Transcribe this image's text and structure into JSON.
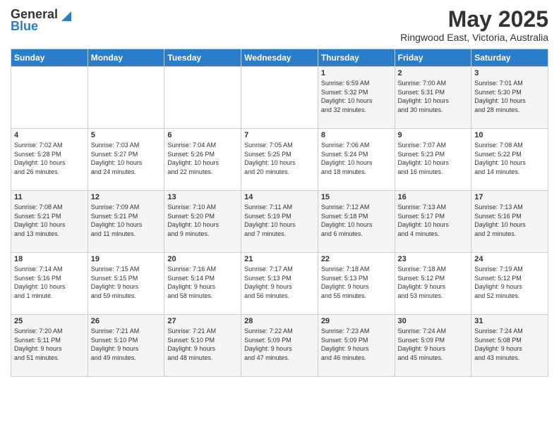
{
  "header": {
    "logo_general": "General",
    "logo_blue": "Blue",
    "month_title": "May 2025",
    "location": "Ringwood East, Victoria, Australia"
  },
  "days_of_week": [
    "Sunday",
    "Monday",
    "Tuesday",
    "Wednesday",
    "Thursday",
    "Friday",
    "Saturday"
  ],
  "weeks": [
    [
      {
        "day": "",
        "info": ""
      },
      {
        "day": "",
        "info": ""
      },
      {
        "day": "",
        "info": ""
      },
      {
        "day": "",
        "info": ""
      },
      {
        "day": "1",
        "info": "Sunrise: 6:59 AM\nSunset: 5:32 PM\nDaylight: 10 hours\nand 32 minutes."
      },
      {
        "day": "2",
        "info": "Sunrise: 7:00 AM\nSunset: 5:31 PM\nDaylight: 10 hours\nand 30 minutes."
      },
      {
        "day": "3",
        "info": "Sunrise: 7:01 AM\nSunset: 5:30 PM\nDaylight: 10 hours\nand 28 minutes."
      }
    ],
    [
      {
        "day": "4",
        "info": "Sunrise: 7:02 AM\nSunset: 5:28 PM\nDaylight: 10 hours\nand 26 minutes."
      },
      {
        "day": "5",
        "info": "Sunrise: 7:03 AM\nSunset: 5:27 PM\nDaylight: 10 hours\nand 24 minutes."
      },
      {
        "day": "6",
        "info": "Sunrise: 7:04 AM\nSunset: 5:26 PM\nDaylight: 10 hours\nand 22 minutes."
      },
      {
        "day": "7",
        "info": "Sunrise: 7:05 AM\nSunset: 5:25 PM\nDaylight: 10 hours\nand 20 minutes."
      },
      {
        "day": "8",
        "info": "Sunrise: 7:06 AM\nSunset: 5:24 PM\nDaylight: 10 hours\nand 18 minutes."
      },
      {
        "day": "9",
        "info": "Sunrise: 7:07 AM\nSunset: 5:23 PM\nDaylight: 10 hours\nand 16 minutes."
      },
      {
        "day": "10",
        "info": "Sunrise: 7:08 AM\nSunset: 5:22 PM\nDaylight: 10 hours\nand 14 minutes."
      }
    ],
    [
      {
        "day": "11",
        "info": "Sunrise: 7:08 AM\nSunset: 5:21 PM\nDaylight: 10 hours\nand 13 minutes."
      },
      {
        "day": "12",
        "info": "Sunrise: 7:09 AM\nSunset: 5:21 PM\nDaylight: 10 hours\nand 11 minutes."
      },
      {
        "day": "13",
        "info": "Sunrise: 7:10 AM\nSunset: 5:20 PM\nDaylight: 10 hours\nand 9 minutes."
      },
      {
        "day": "14",
        "info": "Sunrise: 7:11 AM\nSunset: 5:19 PM\nDaylight: 10 hours\nand 7 minutes."
      },
      {
        "day": "15",
        "info": "Sunrise: 7:12 AM\nSunset: 5:18 PM\nDaylight: 10 hours\nand 6 minutes."
      },
      {
        "day": "16",
        "info": "Sunrise: 7:13 AM\nSunset: 5:17 PM\nDaylight: 10 hours\nand 4 minutes."
      },
      {
        "day": "17",
        "info": "Sunrise: 7:13 AM\nSunset: 5:16 PM\nDaylight: 10 hours\nand 2 minutes."
      }
    ],
    [
      {
        "day": "18",
        "info": "Sunrise: 7:14 AM\nSunset: 5:16 PM\nDaylight: 10 hours\nand 1 minute."
      },
      {
        "day": "19",
        "info": "Sunrise: 7:15 AM\nSunset: 5:15 PM\nDaylight: 9 hours\nand 59 minutes."
      },
      {
        "day": "20",
        "info": "Sunrise: 7:16 AM\nSunset: 5:14 PM\nDaylight: 9 hours\nand 58 minutes."
      },
      {
        "day": "21",
        "info": "Sunrise: 7:17 AM\nSunset: 5:13 PM\nDaylight: 9 hours\nand 56 minutes."
      },
      {
        "day": "22",
        "info": "Sunrise: 7:18 AM\nSunset: 5:13 PM\nDaylight: 9 hours\nand 55 minutes."
      },
      {
        "day": "23",
        "info": "Sunrise: 7:18 AM\nSunset: 5:12 PM\nDaylight: 9 hours\nand 53 minutes."
      },
      {
        "day": "24",
        "info": "Sunrise: 7:19 AM\nSunset: 5:12 PM\nDaylight: 9 hours\nand 52 minutes."
      }
    ],
    [
      {
        "day": "25",
        "info": "Sunrise: 7:20 AM\nSunset: 5:11 PM\nDaylight: 9 hours\nand 51 minutes."
      },
      {
        "day": "26",
        "info": "Sunrise: 7:21 AM\nSunset: 5:10 PM\nDaylight: 9 hours\nand 49 minutes."
      },
      {
        "day": "27",
        "info": "Sunrise: 7:21 AM\nSunset: 5:10 PM\nDaylight: 9 hours\nand 48 minutes."
      },
      {
        "day": "28",
        "info": "Sunrise: 7:22 AM\nSunset: 5:09 PM\nDaylight: 9 hours\nand 47 minutes."
      },
      {
        "day": "29",
        "info": "Sunrise: 7:23 AM\nSunset: 5:09 PM\nDaylight: 9 hours\nand 46 minutes."
      },
      {
        "day": "30",
        "info": "Sunrise: 7:24 AM\nSunset: 5:09 PM\nDaylight: 9 hours\nand 45 minutes."
      },
      {
        "day": "31",
        "info": "Sunrise: 7:24 AM\nSunset: 5:08 PM\nDaylight: 9 hours\nand 43 minutes."
      }
    ]
  ]
}
